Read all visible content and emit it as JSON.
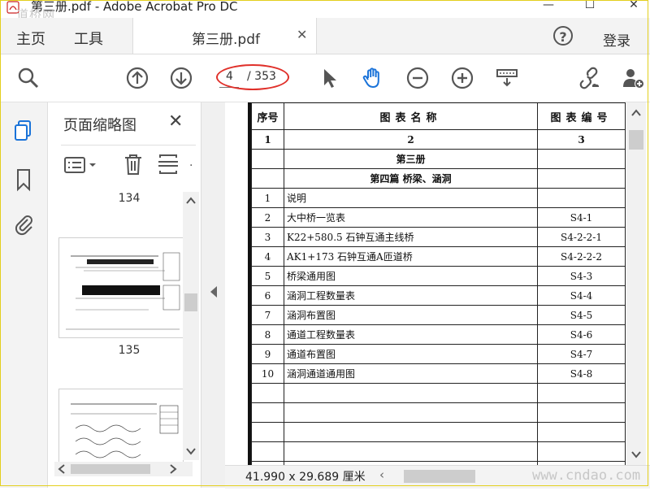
{
  "window": {
    "title": "第三册.pdf - Adobe Acrobat Pro DC",
    "watermark_logo": "道桥网",
    "controls": {
      "minimize": "—",
      "maximize": "☐",
      "close": "✕"
    }
  },
  "tabs": {
    "home": "主页",
    "tools": "工具",
    "document": "第三册.pdf",
    "document_close": "✕",
    "help": "?",
    "login": "登录"
  },
  "toolbar": {
    "page_current": "4",
    "page_total": "/ 353",
    "icons": [
      "search-icon",
      "prev-page-icon",
      "next-page-icon",
      "select-cursor-icon",
      "hand-tool-icon",
      "zoom-out-icon",
      "zoom-in-icon",
      "scroll-mode-icon",
      "share-link-icon",
      "add-user-icon"
    ],
    "highlight_color": "#e0302a",
    "accent_color": "#1a73d9"
  },
  "thumbnails_panel": {
    "title": "页面缩略图",
    "close": "✕",
    "pages": [
      "134",
      "135"
    ]
  },
  "document": {
    "headers": {
      "seq": "序号",
      "name": "图表名称",
      "code": "图表编号"
    },
    "col_numbers": [
      "1",
      "2",
      "3"
    ],
    "volume": "第三册",
    "section": "第四篇  桥梁、涵洞",
    "rows": [
      {
        "seq": "1",
        "name": "说明",
        "code": ""
      },
      {
        "seq": "2",
        "name": "大中桥一览表",
        "code": "S4-1"
      },
      {
        "seq": "3",
        "name": "K22+580.5 石钟互通主线桥",
        "code": "S4-2-2-1"
      },
      {
        "seq": "4",
        "name": "AK1+173 石钟互通A匝道桥",
        "code": "S4-2-2-2"
      },
      {
        "seq": "5",
        "name": "桥梁通用图",
        "code": "S4-3"
      },
      {
        "seq": "6",
        "name": "涵洞工程数量表",
        "code": "S4-4"
      },
      {
        "seq": "7",
        "name": "涵洞布置图",
        "code": "S4-5"
      },
      {
        "seq": "8",
        "name": "通道工程数量表",
        "code": "S4-6"
      },
      {
        "seq": "9",
        "name": "通道布置图",
        "code": "S4-7"
      },
      {
        "seq": "10",
        "name": "涵洞通道通用图",
        "code": "S4-8"
      }
    ]
  },
  "status": {
    "dimensions": "41.990 x 29.689 厘米",
    "watermark_url": "www.cndao.com"
  }
}
